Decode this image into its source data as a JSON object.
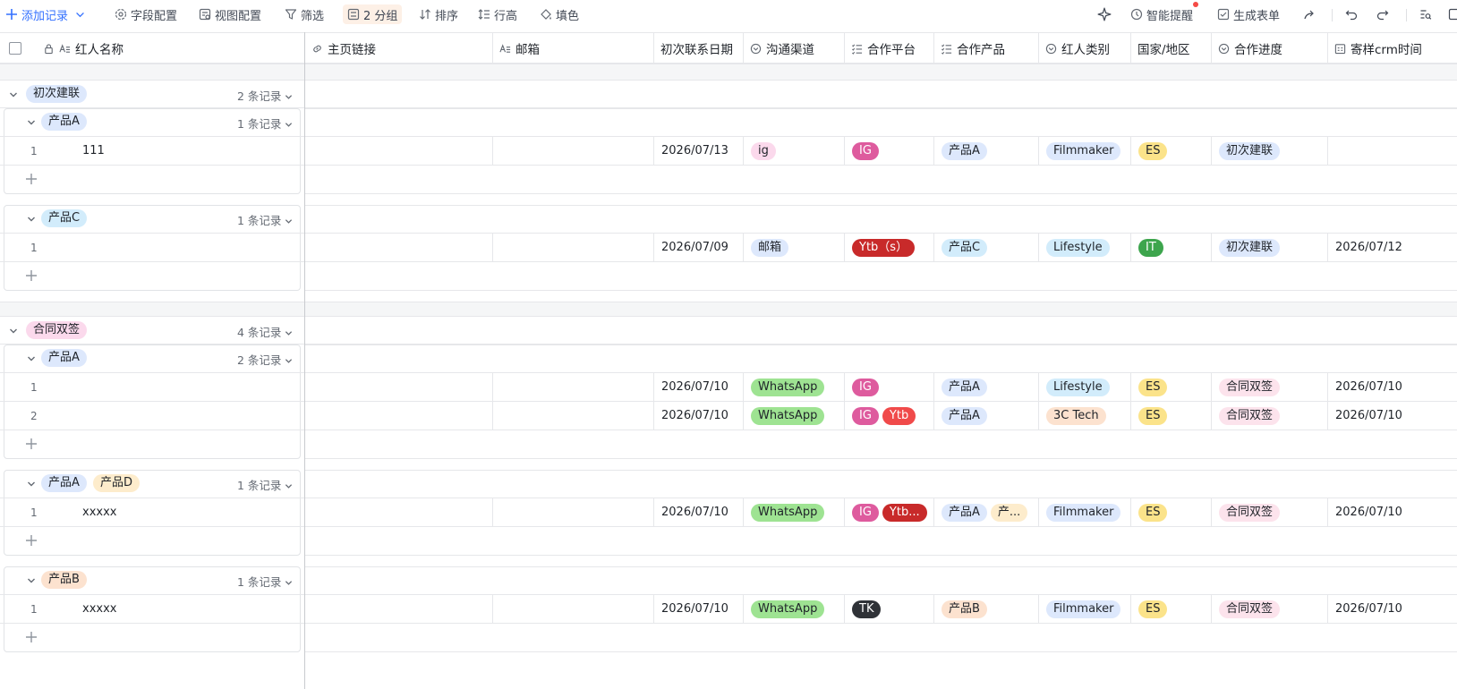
{
  "toolbar": {
    "add_record": "添加记录",
    "field_config": "字段配置",
    "view_config": "视图配置",
    "filter": "筛选",
    "group": "2 分组",
    "sort": "排序",
    "row_height": "行高",
    "fill_color": "填色",
    "smart_reminder": "智能提醒",
    "generate_form": "生成表单"
  },
  "columns": [
    "红人名称",
    "主页链接",
    "邮箱",
    "初次联系日期",
    "沟通渠道",
    "合作平台",
    "合作产品",
    "红人类别",
    "国家/地区",
    "合作进度",
    "寄样crm时间"
  ],
  "colors": {
    "accent": "#3370ff",
    "tag_blue": "#dde8fc",
    "tag_lightblue": "#d2ecfb",
    "tag_pink": "#fbd9ec",
    "tag_green": "#9ee392",
    "tag_ig": "#de5b9e",
    "tag_ytb": "#c82a2a",
    "tag_ytb2": "#f04a4a",
    "tag_tk": "#2f3237",
    "tag_yellow": "#fbe38a",
    "tag_it": "#3da54d",
    "tag_cyan": "#d2ecfb",
    "tag_orange": "#fce2cf",
    "tag_contract": "#fce3ec",
    "tag_ivory": "#fdeccc"
  },
  "groups": [
    {
      "label": "初次建联",
      "count": "2 条记录",
      "subgroups": [
        {
          "labels": [
            "产品A"
          ],
          "count": "1 条记录",
          "rows": [
            {
              "num": "1",
              "name": "111",
              "date": "2026/07/13",
              "channel": "ig",
              "platform": [
                "IG"
              ],
              "product": [
                "产品A"
              ],
              "category": "Filmmaker",
              "country": "ES",
              "progress": "初次建联",
              "crm": ""
            }
          ]
        },
        {
          "labels": [
            "产品C"
          ],
          "count": "1 条记录",
          "rows": [
            {
              "num": "1",
              "name": "",
              "date": "2026/07/09",
              "channel": "邮箱",
              "platform": [
                "Ytb（s）"
              ],
              "product": [
                "产品C"
              ],
              "category": "Lifestyle",
              "country": "IT",
              "progress": "初次建联",
              "crm": "2026/07/12"
            }
          ]
        }
      ]
    },
    {
      "label": "合同双签",
      "count": "4 条记录",
      "subgroups": [
        {
          "labels": [
            "产品A"
          ],
          "count": "2 条记录",
          "rows": [
            {
              "num": "1",
              "name": "",
              "date": "2026/07/10",
              "channel": "WhatsApp",
              "platform": [
                "IG"
              ],
              "product": [
                "产品A"
              ],
              "category": "Lifestyle",
              "country": "ES",
              "progress": "合同双签",
              "crm": "2026/07/10"
            },
            {
              "num": "2",
              "name": "",
              "date": "2026/07/10",
              "channel": "WhatsApp",
              "platform": [
                "IG",
                "Ytb"
              ],
              "product": [
                "产品A"
              ],
              "category": "3C Tech",
              "country": "ES",
              "progress": "合同双签",
              "crm": "2026/07/10"
            }
          ]
        },
        {
          "labels": [
            "产品A",
            "产品D"
          ],
          "count": "1 条记录",
          "rows": [
            {
              "num": "1",
              "name": "xxxxx",
              "date": "2026/07/10",
              "channel": "WhatsApp",
              "platform": [
                "IG",
                "Ytb..."
              ],
              "product": [
                "产品A",
                "产..."
              ],
              "category": "Filmmaker",
              "country": "ES",
              "progress": "合同双签",
              "crm": "2026/07/10"
            }
          ]
        },
        {
          "labels": [
            "产品B"
          ],
          "count": "1 条记录",
          "rows": [
            {
              "num": "1",
              "name": "xxxxx",
              "date": "2026/07/10",
              "channel": "WhatsApp",
              "platform": [
                "TK"
              ],
              "product": [
                "产品B"
              ],
              "category": "Filmmaker",
              "country": "ES",
              "progress": "合同双签",
              "crm": "2026/07/10"
            }
          ]
        }
      ]
    }
  ]
}
